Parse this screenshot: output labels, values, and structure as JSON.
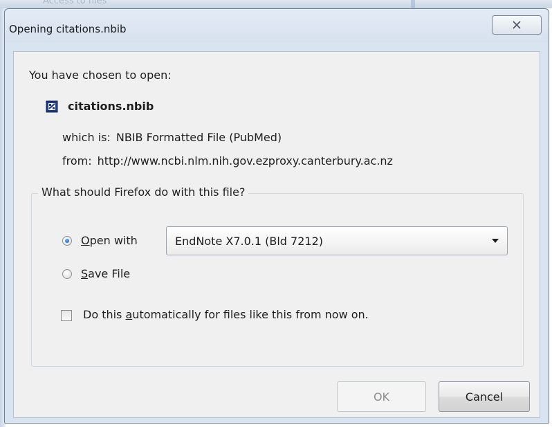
{
  "background_title_fragment": "Access to files",
  "dialog": {
    "title": "Opening citations.nbib",
    "close_icon": "close-icon"
  },
  "file": {
    "heading": "You have chosen to open:",
    "icon": "nbib-file-icon",
    "name": "citations.nbib",
    "which_is_label": "which is:",
    "which_is_value": "NBIB Formatted File (PubMed)",
    "from_label": "from:",
    "from_value": "http://www.ncbi.nlm.nih.gov.ezproxy.canterbury.ac.nz"
  },
  "action": {
    "question": "What should Firefox do with this file?",
    "open_with_prefix": "",
    "open_with_accel": "O",
    "open_with_rest": "pen with",
    "open_with_selected": true,
    "app_selected": "EndNote X7.0.1 (Bld 7212)",
    "save_file_accel": "S",
    "save_file_rest": "ave File",
    "save_file_selected": false,
    "auto_prefix": "Do this ",
    "auto_accel": "a",
    "auto_rest": "utomatically for files like this from now on.",
    "auto_checked": false
  },
  "buttons": {
    "ok": "OK",
    "cancel": "Cancel",
    "ok_enabled": false
  }
}
